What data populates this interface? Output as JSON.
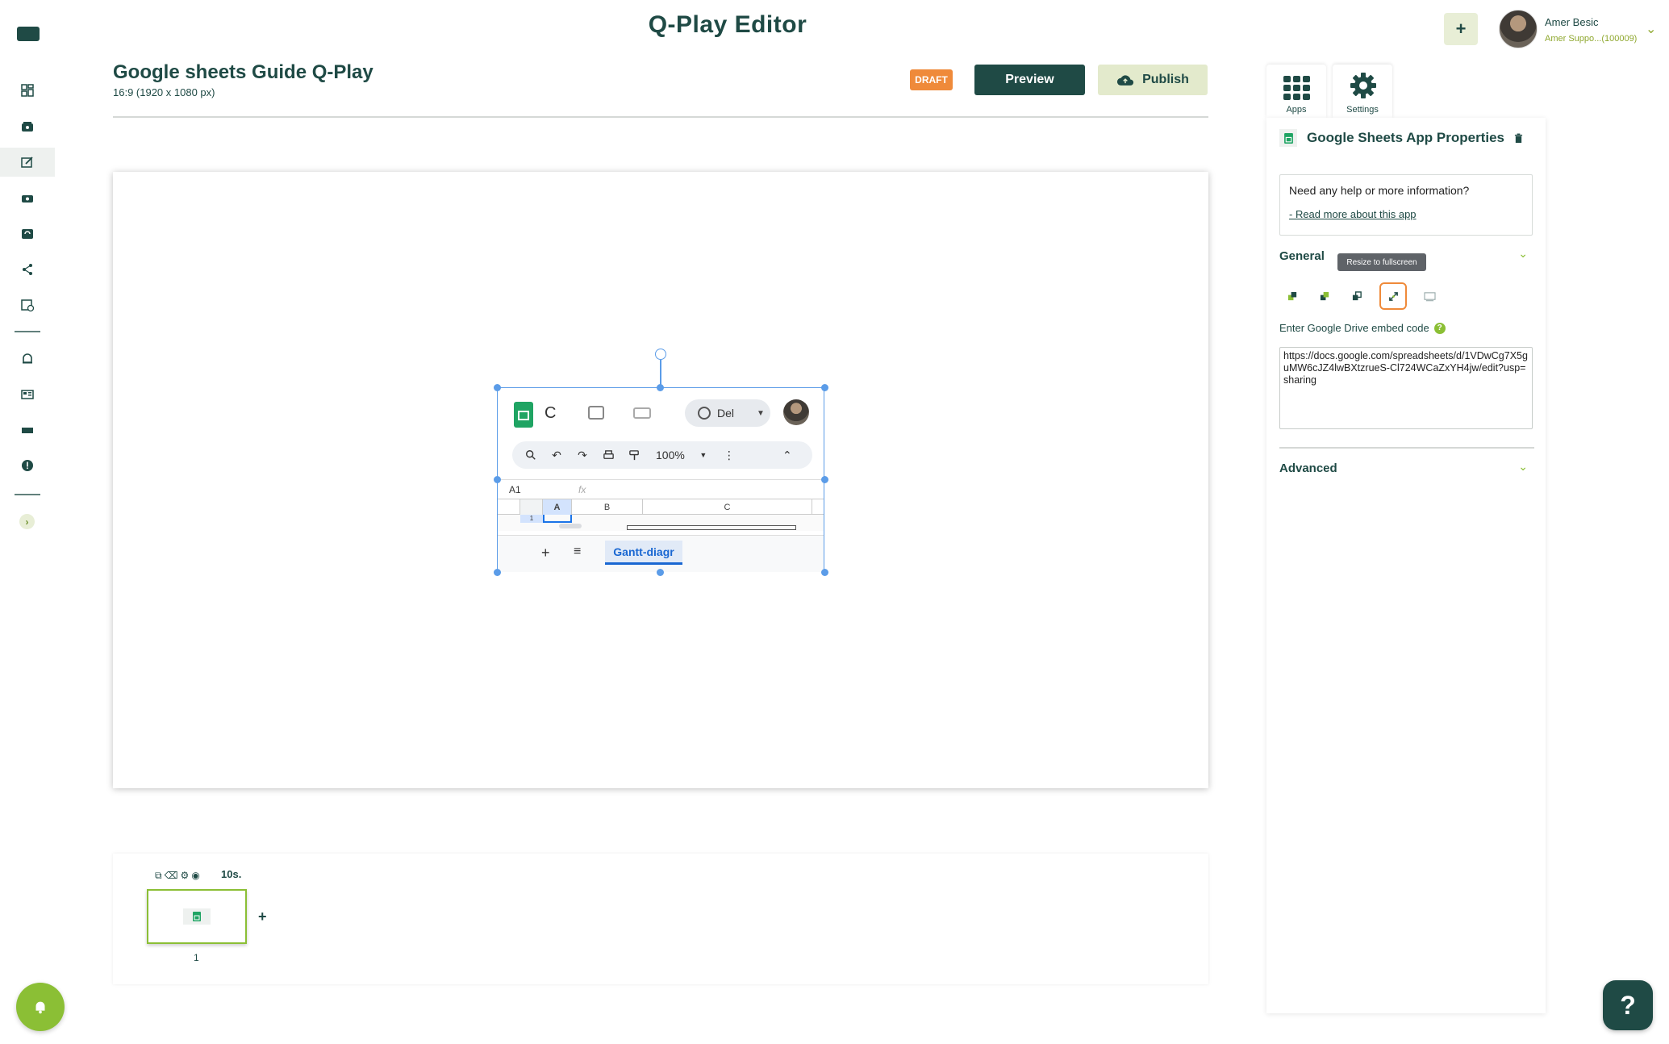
{
  "app": {
    "title": "Q-Play Editor"
  },
  "user": {
    "name": "Amer Besic",
    "subtitle": "Amer Suppo...(100009)"
  },
  "document": {
    "title": "Google sheets Guide Q-Play",
    "resolution": "16:9 (1920 x 1080 px)",
    "status": "DRAFT",
    "preview_label": "Preview",
    "publish_label": "Publish"
  },
  "sidebar": {
    "icons": [
      "dashboard-icon",
      "media-icon",
      "editor-icon",
      "devices-icon",
      "playlist-icon",
      "share-icon",
      "schedule-icon",
      "alerts-icon",
      "templates-icon",
      "screen-icon",
      "info-icon"
    ],
    "active": "editor-icon"
  },
  "sheets_widget": {
    "doc_initial": "C",
    "share_label": "Del",
    "zoom": "100%",
    "cell_ref": "A1",
    "fx": "fx",
    "columns": [
      "A",
      "B",
      "C"
    ],
    "row_number": "1",
    "sheet_tab": "Gantt-diagr"
  },
  "timeline": {
    "duration": "10s.",
    "slide_number": "1",
    "add": "+"
  },
  "panel": {
    "tabs": [
      {
        "label": "Apps"
      },
      {
        "label": "Settings"
      }
    ],
    "title": "Google Sheets App Properties",
    "help_text": "Need any help or more information?",
    "help_link": "- Read more about this app",
    "general_label": "General",
    "tooltip": "Resize to fullscreen",
    "embed_label": "Enter Google Drive embed code",
    "embed_value": "https://docs.google.com/spreadsheets/d/1VDwCg7X5guMW6cJZ4lwBXtzrueS-Cl724WCaZxYH4jw/edit?usp=sharing",
    "advanced_label": "Advanced"
  },
  "header_add": "+",
  "help_button": "?",
  "colors": {
    "brand_dark": "#1f4a45",
    "brand_green": "#8bbf35",
    "draft_orange": "#ef8a3a",
    "selection_blue": "#5b9ce8"
  }
}
